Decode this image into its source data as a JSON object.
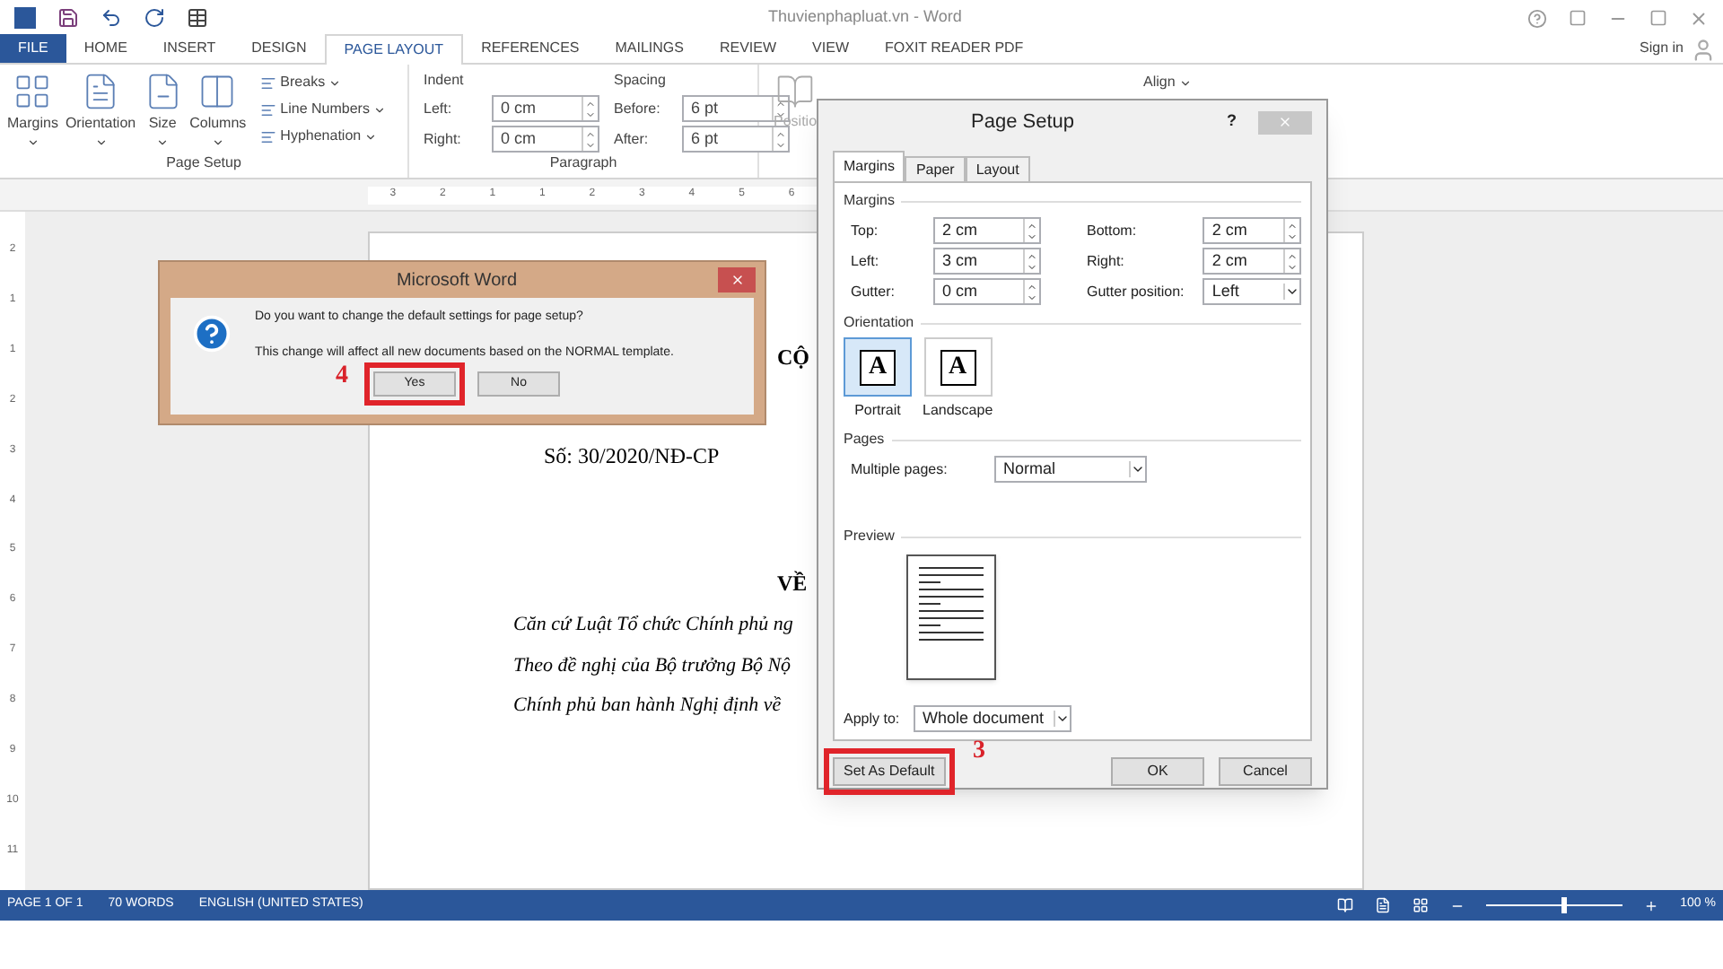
{
  "window": {
    "title": "Thuvienphapluat.vn - Word",
    "sign_in": "Sign in"
  },
  "tabs": [
    {
      "label": "FILE",
      "kind": "file",
      "selected": false
    },
    {
      "label": "HOME",
      "kind": "tab",
      "selected": false
    },
    {
      "label": "INSERT",
      "kind": "tab",
      "selected": false
    },
    {
      "label": "DESIGN",
      "kind": "tab",
      "selected": false
    },
    {
      "label": "PAGE LAYOUT",
      "kind": "tab",
      "selected": true
    },
    {
      "label": "REFERENCES",
      "kind": "tab",
      "selected": false
    },
    {
      "label": "MAILINGS",
      "kind": "tab",
      "selected": false
    },
    {
      "label": "REVIEW",
      "kind": "tab",
      "selected": false
    },
    {
      "label": "VIEW",
      "kind": "tab",
      "selected": false
    },
    {
      "label": "FOXIT READER PDF",
      "kind": "tab",
      "selected": false
    }
  ],
  "ribbon": {
    "page_setup": {
      "label": "Page Setup",
      "big_buttons": [
        "Margins",
        "Orientation",
        "Size",
        "Columns"
      ],
      "small_buttons": [
        "Breaks",
        "Line Numbers",
        "Hyphenation"
      ]
    },
    "paragraph": {
      "label": "Paragraph",
      "indent_label": "Indent",
      "spacing_label": "Spacing",
      "indent": [
        {
          "label": "Left:",
          "value": "0 cm"
        },
        {
          "label": "Right:",
          "value": "0 cm"
        }
      ],
      "spacing": [
        {
          "label": "Before:",
          "value": "6 pt"
        },
        {
          "label": "After:",
          "value": "6 pt"
        }
      ]
    },
    "arrange": {
      "position": "Positio",
      "align": "Align"
    }
  },
  "ruler": {
    "horizontal": [
      "3",
      "2",
      "1",
      "1",
      "2",
      "3",
      "4",
      "5",
      "6"
    ],
    "vertical": [
      "2",
      "1",
      "1",
      "2",
      "3",
      "4",
      "5",
      "6",
      "7",
      "8",
      "9",
      "10",
      "11"
    ]
  },
  "document": {
    "lines": [
      {
        "kind": "heading",
        "text": "CỘ"
      },
      {
        "kind": "center",
        "text": "Số: 30/2020/NĐ-CP"
      },
      {
        "kind": "heading",
        "text": "VỀ"
      },
      {
        "kind": "italic",
        "text": "Căn cứ Luật Tổ chức Chính phủ ng"
      },
      {
        "kind": "italic",
        "text": "Theo đề nghị của Bộ trưởng Bộ Nộ"
      },
      {
        "kind": "italic",
        "text": "Chính phủ ban hành Nghị định về"
      }
    ]
  },
  "page_setup_dialog": {
    "title": "Page Setup",
    "help": "?",
    "tabs": [
      {
        "label": "Margins",
        "selected": true
      },
      {
        "label": "Paper",
        "selected": false
      },
      {
        "label": "Layout",
        "selected": false
      }
    ],
    "margins_label": "Margins",
    "margins": [
      {
        "label": "Top:",
        "value": "2 cm",
        "kind": "spin"
      },
      {
        "label": "Bottom:",
        "value": "2 cm",
        "kind": "spin"
      },
      {
        "label": "Left:",
        "value": "3 cm",
        "kind": "spin"
      },
      {
        "label": "Right:",
        "value": "2 cm",
        "kind": "spin"
      },
      {
        "label": "Gutter:",
        "value": "0 cm",
        "kind": "spin"
      },
      {
        "label": "Gutter position:",
        "value": "Left",
        "kind": "dropdown"
      }
    ],
    "orientation_label": "Orientation",
    "orientations": [
      {
        "label": "Portrait",
        "glyph": "A",
        "selected": true
      },
      {
        "label": "Landscape",
        "glyph": "A",
        "selected": false
      }
    ],
    "pages_label": "Pages",
    "multiple_pages": {
      "label": "Multiple pages:",
      "value": "Normal"
    },
    "preview_label": "Preview",
    "apply_to": {
      "label": "Apply to:",
      "value": "Whole document"
    },
    "buttons": [
      {
        "label": "Set As Default",
        "kind": "default",
        "highlighted": true,
        "step": "3"
      },
      {
        "label": "OK",
        "kind": "ok",
        "highlighted": false
      },
      {
        "label": "Cancel",
        "kind": "cancel",
        "highlighted": false
      }
    ]
  },
  "message_box": {
    "title": "Microsoft Word",
    "question": "Do you want to change the default settings for page setup?",
    "note": "This change will affect all new documents based on the NORMAL template.",
    "buttons": [
      {
        "label": "Yes",
        "highlighted": true,
        "step": "4"
      },
      {
        "label": "No",
        "highlighted": false
      }
    ]
  },
  "status_bar": {
    "items": [
      "PAGE 1 OF 1",
      "70 WORDS",
      "ENGLISH (UNITED STATES)"
    ],
    "zoom": "100 %",
    "zoom_level": {
      "level": 0.55
    }
  }
}
